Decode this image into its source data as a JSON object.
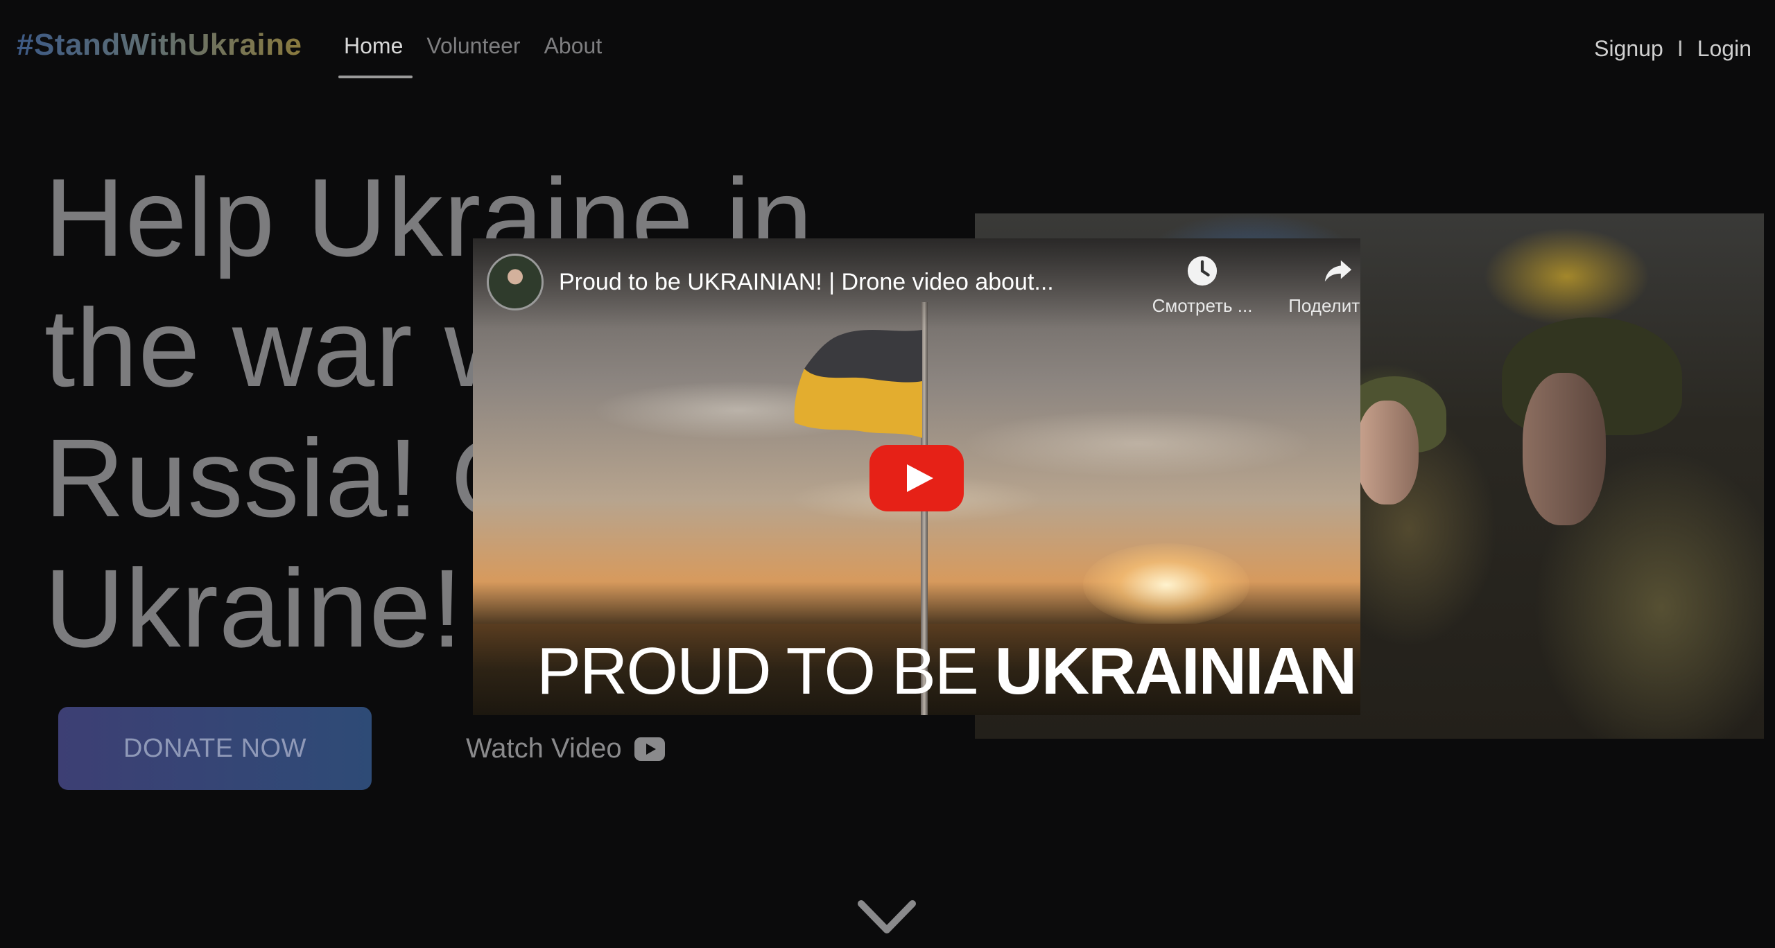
{
  "nav": {
    "logo": "#StandWithUkraine",
    "links": [
      {
        "label": "Home",
        "active": true
      },
      {
        "label": "Volunteer",
        "active": false
      },
      {
        "label": "About",
        "active": false
      }
    ],
    "auth": {
      "signup": "Signup",
      "separator": "I",
      "login": "Login"
    }
  },
  "hero": {
    "headline_lines": [
      "Help Ukraine in",
      "the war w",
      "Russia! G",
      "Ukraine!"
    ],
    "donate_label": "DONATE NOW",
    "watch_label": "Watch Video",
    "watch_icon": "youtube-icon"
  },
  "video": {
    "title": "Proud to be UKRAINIAN! | Drone video about...",
    "watch_later": "Смотреть ...",
    "share": "Поделиться",
    "caption_light": "PROUD TO BE ",
    "caption_bold": "UKRAINIAN!",
    "play_color": "#e62117"
  },
  "scroll_icon": "chevron-down-icon",
  "colors": {
    "background": "#0b0b0c",
    "donate_start": "#3d3f74",
    "donate_end": "#2e4b76"
  }
}
